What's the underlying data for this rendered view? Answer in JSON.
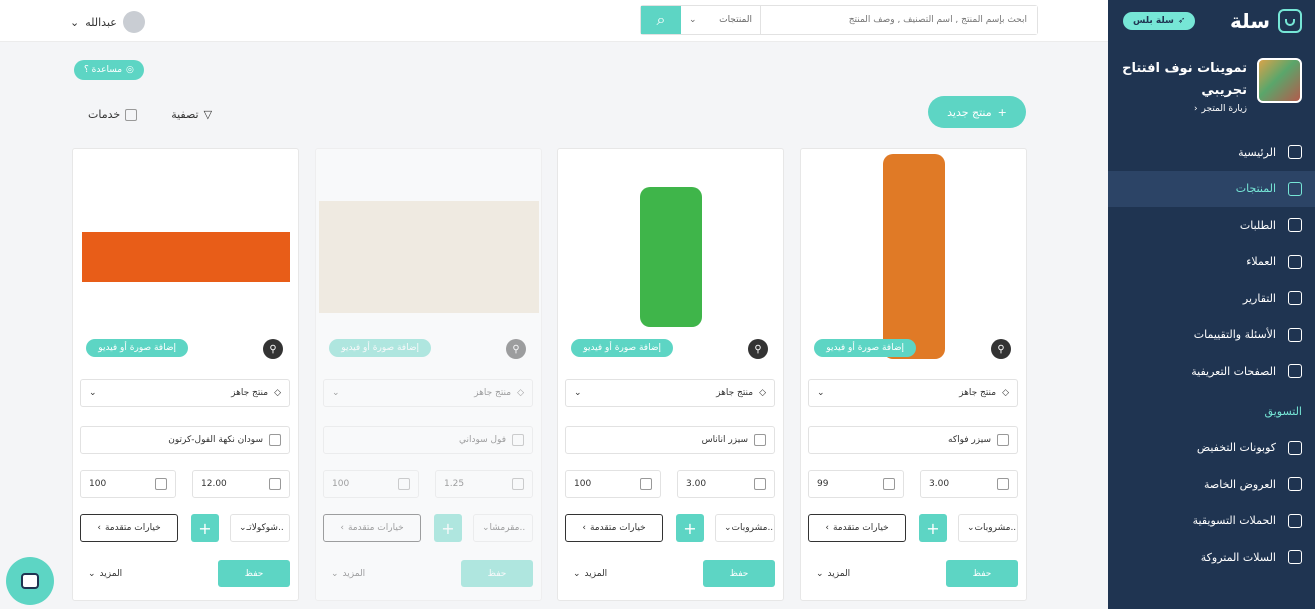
{
  "topbar": {
    "user_name": "عبدالله",
    "search_placeholder": "ابحث بإسم المنتج , اسم التصنيف , وصف المنتج",
    "search_scope": "المنتجات"
  },
  "toolbar": {
    "help_label": "مساعدة ؟",
    "services_label": "خدمات",
    "filter_label": "تصفية",
    "new_product_label": "منتج جديد"
  },
  "sidebar": {
    "brand": "سلة",
    "plus_label": "سلة بلس",
    "store_name": "تموينات نوف افتتاح تجريبي",
    "visit_store": "زيارة المتجر",
    "items": [
      {
        "label": "الرئيسية"
      },
      {
        "label": "المنتجات"
      },
      {
        "label": "الطلبات"
      },
      {
        "label": "العملاء"
      },
      {
        "label": "التقارير"
      },
      {
        "label": "الأسئلة والتقييمات"
      },
      {
        "label": "الصفحات التعريفية"
      }
    ],
    "marketing_title": "التسويق",
    "marketing_items": [
      {
        "label": "كوبونات التخفيض"
      },
      {
        "label": "العروض الخاصة"
      },
      {
        "label": "الحملات التسويقية"
      },
      {
        "label": "السلات المتروكة"
      }
    ]
  },
  "products": [
    {
      "type": "منتج جاهز",
      "name": "سيزر فواكه",
      "price": "3.00",
      "qty": "99",
      "category": "مشروبات..",
      "add_media": "إضافة صورة أو فيديو",
      "advanced": "خيارات متقدمة",
      "save": "حفظ",
      "more": "المزيد",
      "image_color": "#e07a26"
    },
    {
      "type": "منتج جاهز",
      "name": "سيزر اناناس",
      "price": "3.00",
      "qty": "100",
      "category": "مشروبات..",
      "add_media": "إضافة صورة أو فيديو",
      "advanced": "خيارات متقدمة",
      "save": "حفظ",
      "more": "المزيد",
      "image_color": "#3fb54a"
    },
    {
      "type": "منتج جاهز",
      "name": "فول سوداني",
      "price": "1.25",
      "qty": "100",
      "category": "مقرمشا..",
      "add_media": "إضافة صورة أو فيديو",
      "advanced": "خيارات متقدمة",
      "save": "حفظ",
      "more": "المزيد",
      "image_color": "#e9ddc7"
    },
    {
      "type": "منتج جاهز",
      "name": "سودان نكهة الفول-كرتون",
      "price": "12.00",
      "qty": "100",
      "category": "شوكولاتـ..",
      "add_media": "إضافة صورة أو فيديو",
      "advanced": "خيارات متقدمة",
      "save": "حفظ",
      "more": "المزيد",
      "image_color": "#e85d18"
    }
  ]
}
